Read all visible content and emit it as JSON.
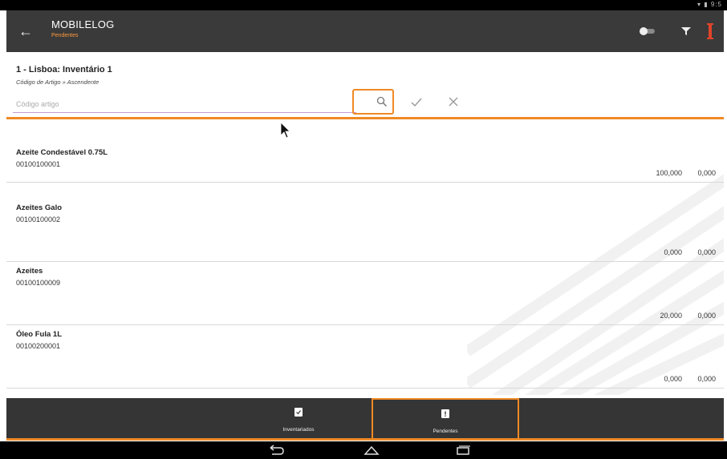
{
  "status_bar": {
    "icons_text": "▾ ▮ 9:5"
  },
  "app_bar": {
    "title": "MOBILELOG",
    "subtitle": "Pendentes",
    "icons": [
      "back-arrow-icon",
      "toggle-icon",
      "filter-icon",
      "bar-icon"
    ],
    "accent_color": "#f08a24"
  },
  "header": {
    "title": "1 - Lisboa: Inventário 1",
    "sort_label": "Código de Artigo » Ascendente",
    "search_placeholder": "Código artigo",
    "search_value": ""
  },
  "items": [
    {
      "name": "Azeite Condestável 0.75L",
      "code": "00100100001",
      "qty": "100,000",
      "qty2": "0,000"
    },
    {
      "name": "Azeites Galo",
      "code": "00100100002",
      "qty": "0,000",
      "qty2": "0,000"
    },
    {
      "name": "Azeites",
      "code": "00100100009",
      "qty": "20,000",
      "qty2": "0,000"
    },
    {
      "name": "Óleo Fula 1L",
      "code": "00100200001",
      "qty": "0,000",
      "qty2": "0,000"
    }
  ],
  "bottom_tabs": [
    {
      "label": "Inventariados",
      "icon": "clipboard-check-icon",
      "active": false
    },
    {
      "label": "Pendentes",
      "icon": "clipboard-alert-icon",
      "active": true
    }
  ]
}
